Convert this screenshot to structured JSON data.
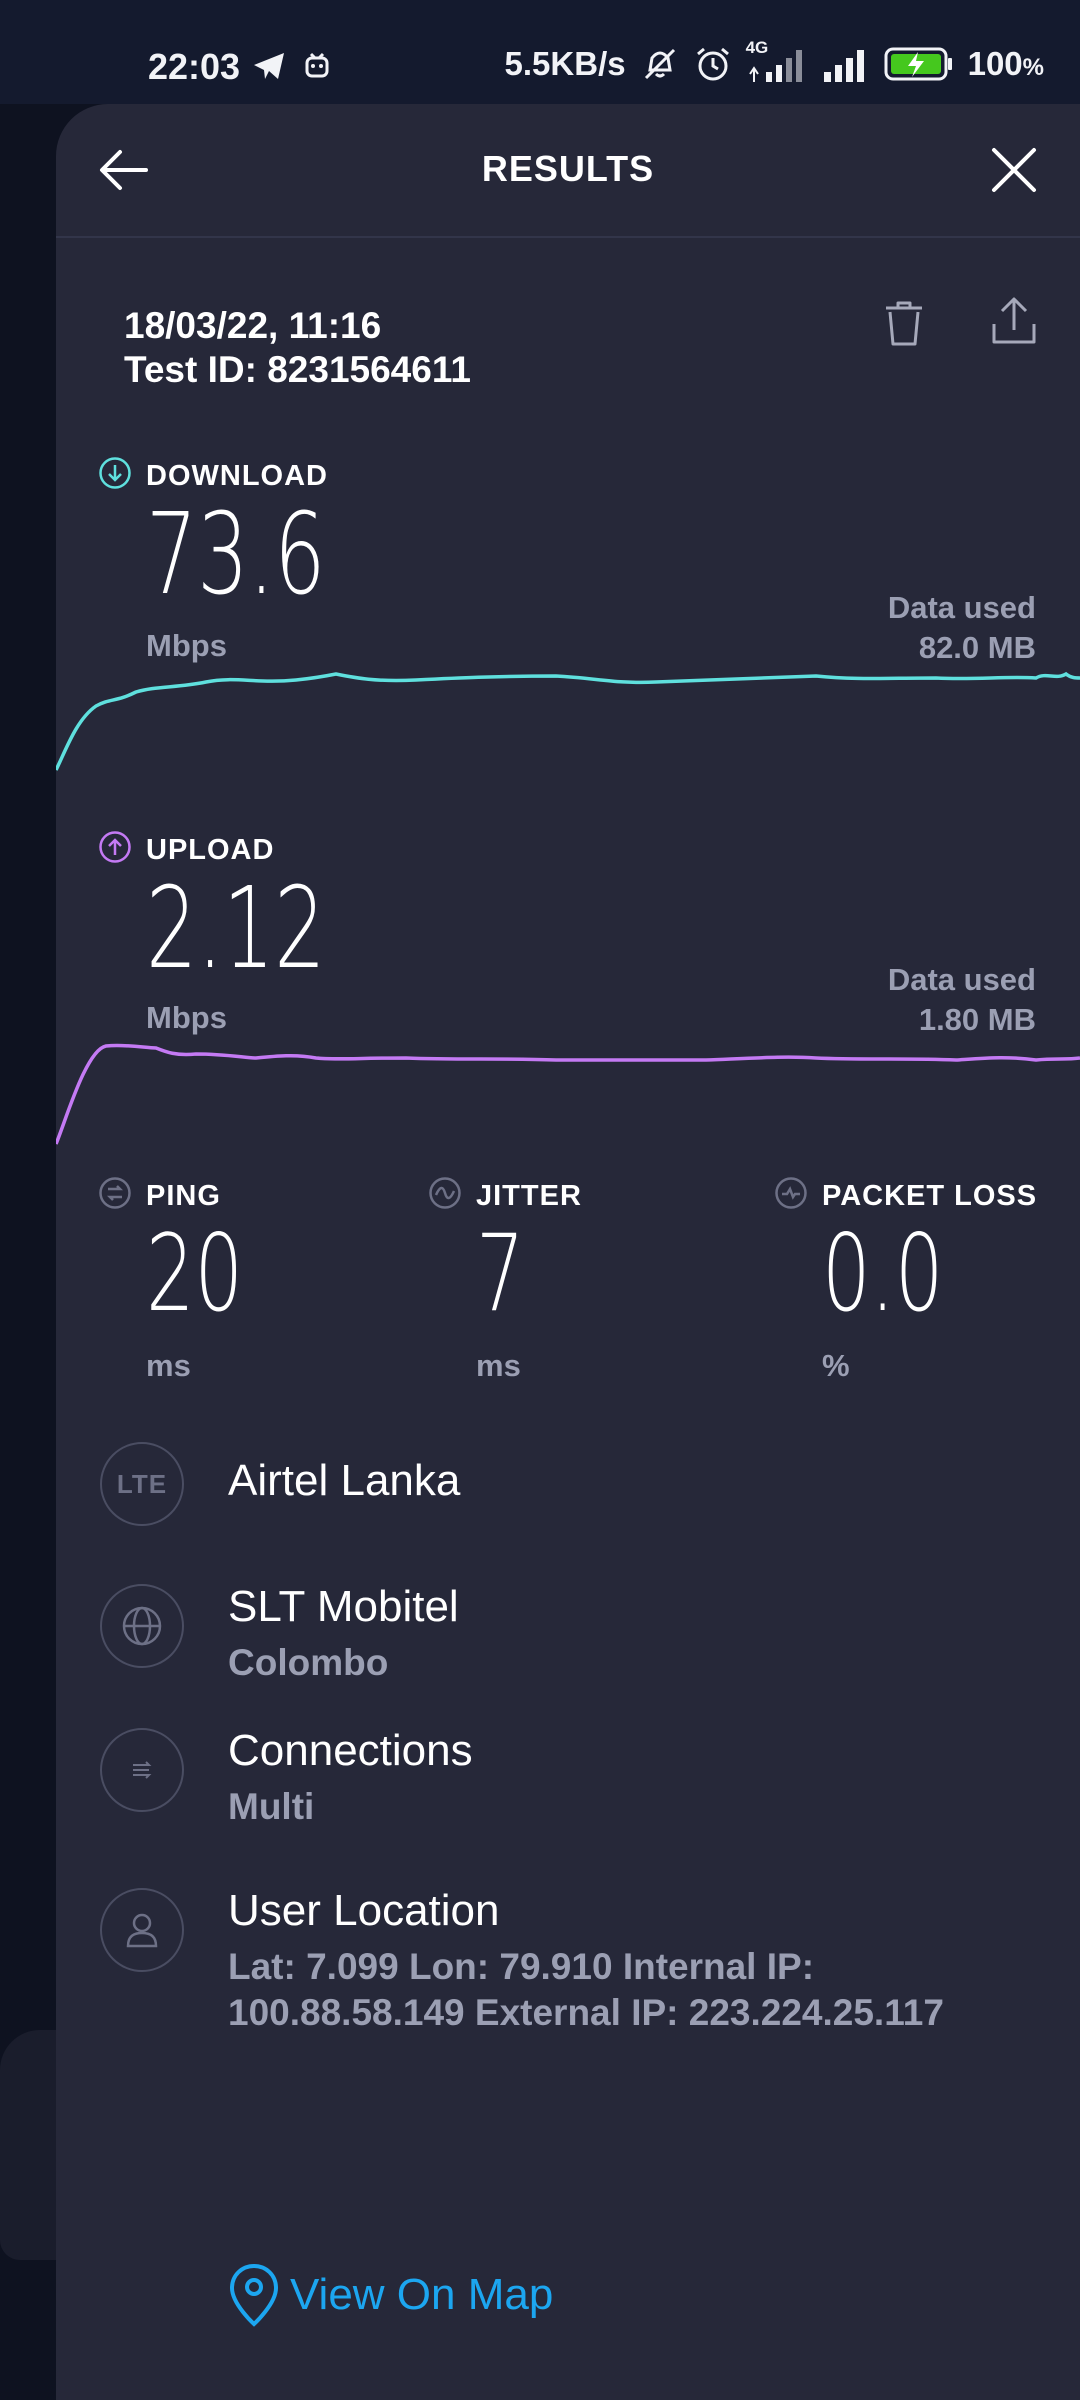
{
  "status_bar": {
    "time": "22:03",
    "net_speed": "5.5KB/s",
    "network_type": "4G",
    "battery": "100",
    "battery_unit": "%"
  },
  "header": {
    "title": "RESULTS"
  },
  "test": {
    "datetime": "18/03/22, 11:16",
    "test_id": "Test ID: 8231564611"
  },
  "download": {
    "label": "DOWNLOAD",
    "value": "73.6",
    "unit": "Mbps",
    "data_used_label": "Data used",
    "data_used": "82.0 MB",
    "color": "#5fe0de"
  },
  "upload": {
    "label": "UPLOAD",
    "value": "2.12",
    "unit": "Mbps",
    "data_used_label": "Data used",
    "data_used": "1.80 MB",
    "color": "#c47af4"
  },
  "stats": {
    "ping": {
      "label": "PING",
      "value": "20",
      "unit": "ms"
    },
    "jitter": {
      "label": "JITTER",
      "value": "7",
      "unit": "ms"
    },
    "packet_loss": {
      "label": "PACKET LOSS",
      "value": "0.0",
      "unit": "%"
    }
  },
  "info": {
    "carrier": {
      "icon_text": "LTE",
      "title": "Airtel Lanka"
    },
    "server": {
      "title": "SLT Mobitel",
      "subtitle": "Colombo"
    },
    "connections": {
      "title": "Connections",
      "subtitle": "Multi"
    },
    "location": {
      "title": "User Location",
      "line1": "Lat: 7.099 Lon: 79.910  Internal IP:",
      "line2": "100.88.58.149 External IP: 223.224.25.117"
    }
  },
  "map_link": {
    "label": "View On Map",
    "color": "#1ca6f0"
  }
}
